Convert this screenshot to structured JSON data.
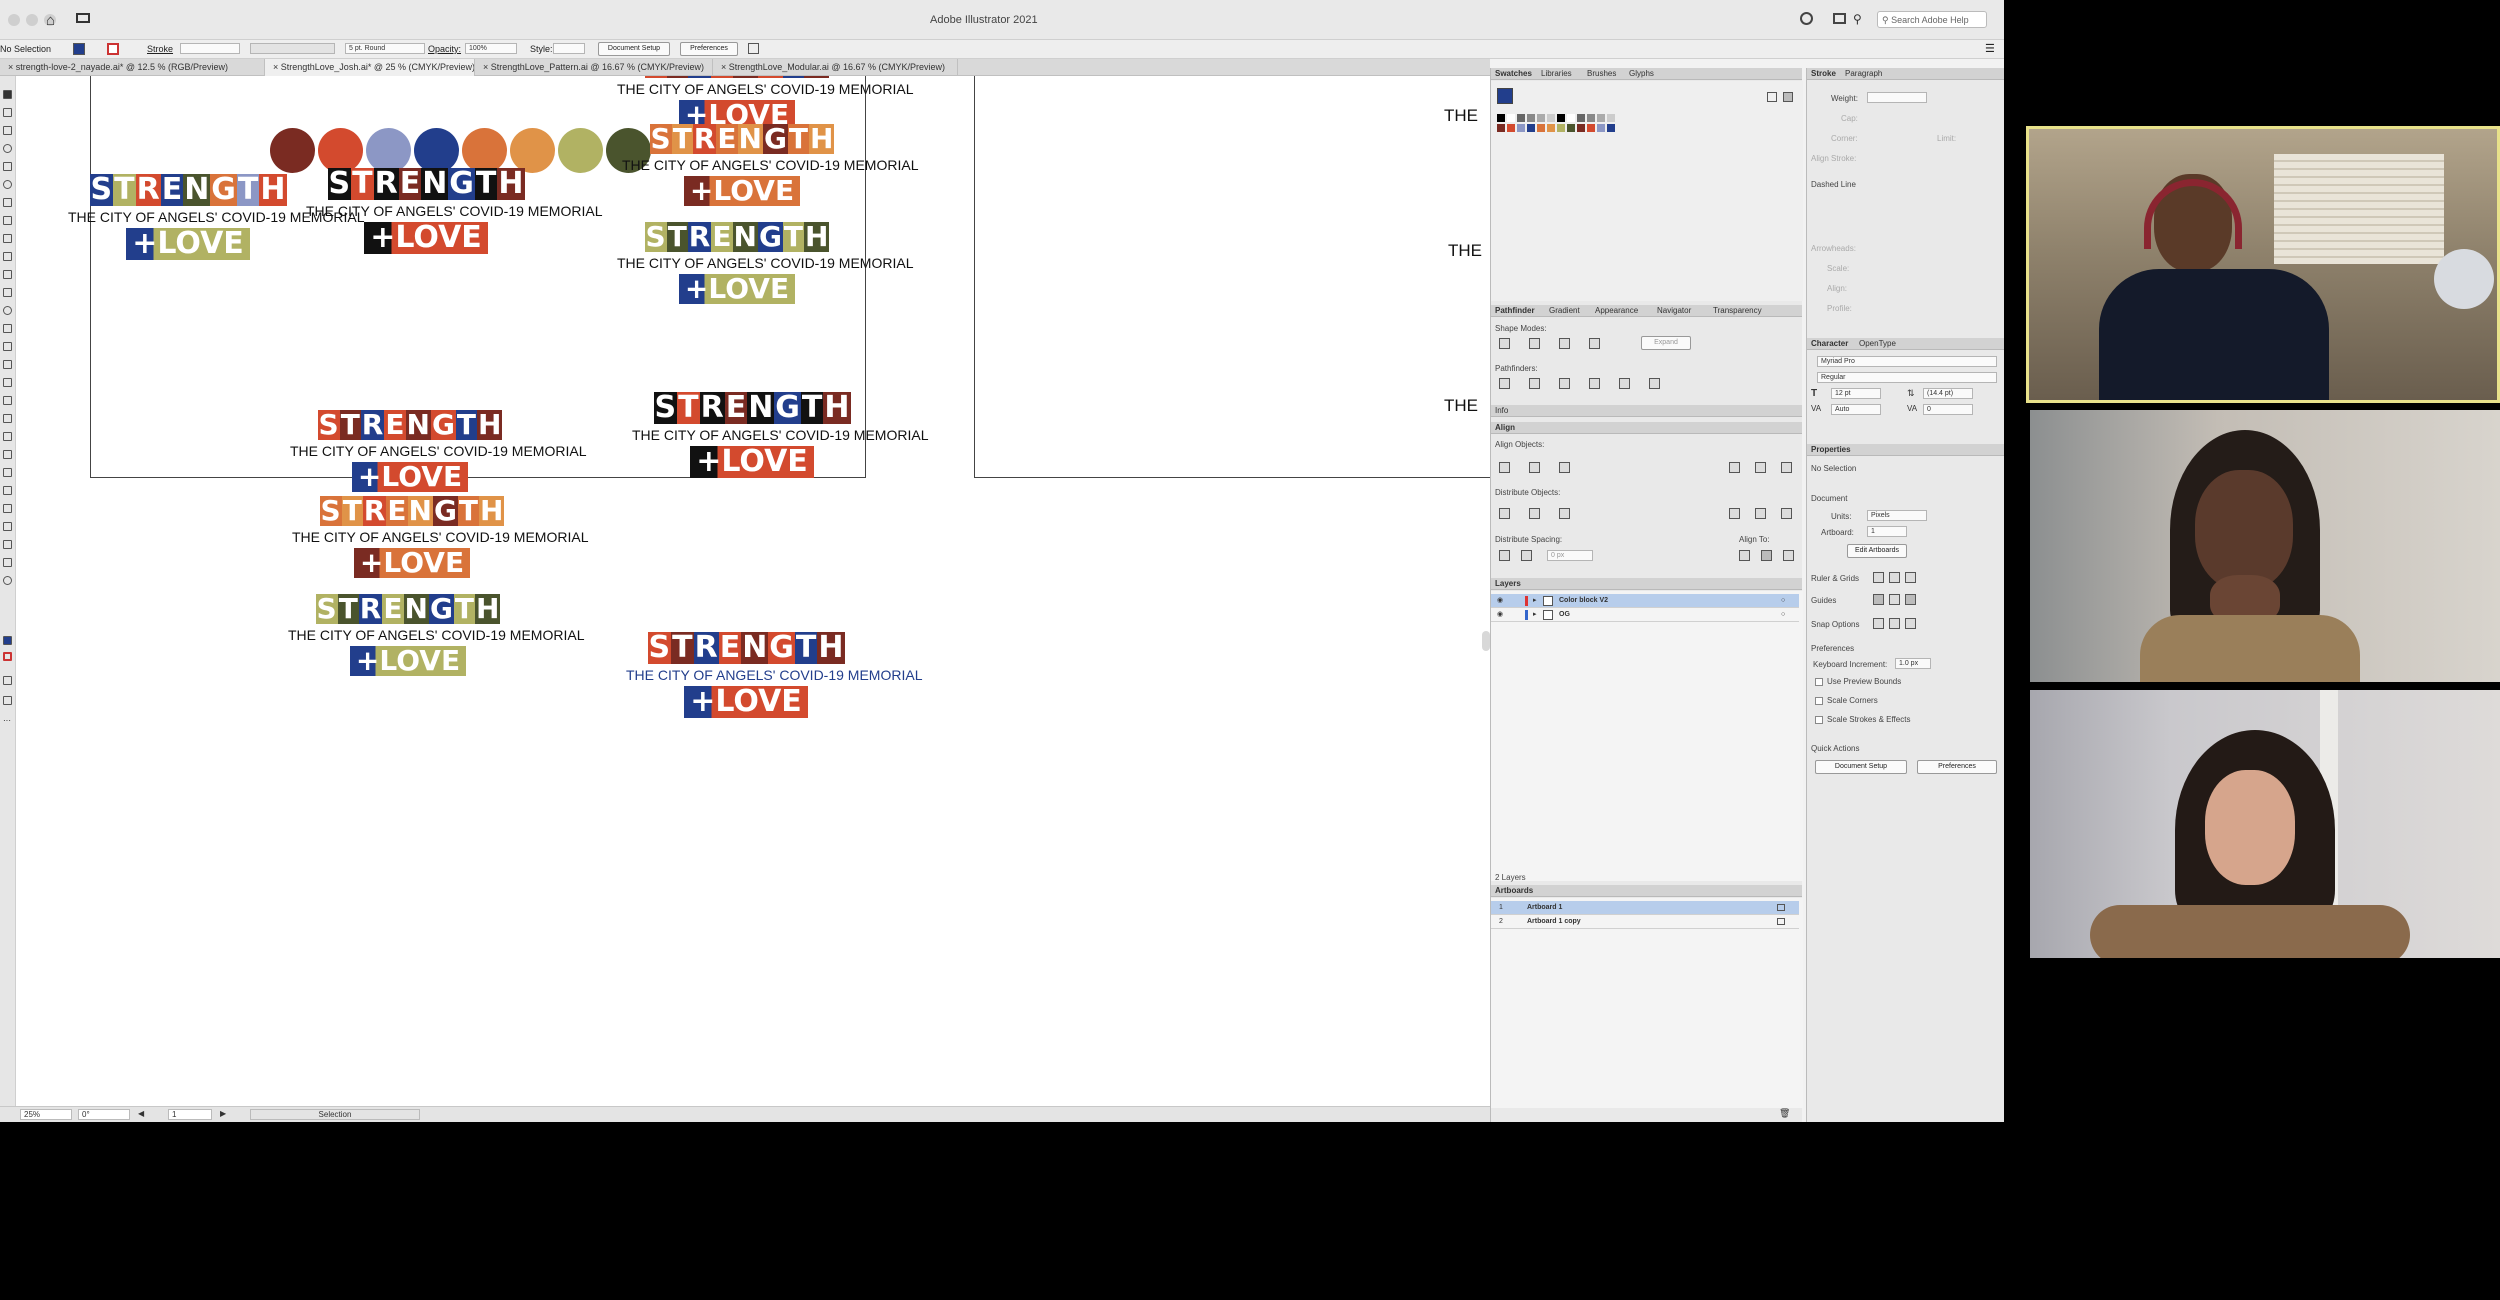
{
  "app": {
    "title": "Adobe Illustrator 2021",
    "search_placeholder": "Search Adobe Help"
  },
  "control_bar": {
    "selection": "No Selection",
    "stroke_label": "Stroke",
    "brush": "5 pt. Round",
    "opacity_label": "Opacity:",
    "opacity_value": "100%",
    "style_label": "Style:",
    "document_setup": "Document Setup",
    "preferences": "Preferences"
  },
  "tabs": [
    {
      "label": "strength-love-2_nayade.ai* @ 12.5 % (RGB/Preview)"
    },
    {
      "label": "StrengthLove_Josh.ai* @ 25 % (CMYK/Preview)"
    },
    {
      "label": "StrengthLove_Pattern.ai @ 16.67 % (CMYK/Preview)"
    },
    {
      "label": "StrengthLove_Modular.ai @ 16.67 % (CMYK/Preview)"
    }
  ],
  "artwork": {
    "headline": "STRENGTH",
    "subtitle": "THE CITY OF ANGELS' COVID-19 MEMORIAL",
    "love": "+LOVE",
    "partial_the": "THE"
  },
  "palette": [
    "#7a2b22",
    "#d34a2e",
    "#8c97c5",
    "#223e8c",
    "#d9733a",
    "#e09348",
    "#b1b263",
    "#4a542d"
  ],
  "status": {
    "zoom": "25%",
    "rotation": "0°",
    "artboard_num": "1",
    "tool": "Selection"
  },
  "swatch_panel": {
    "tabs": [
      "Swatches",
      "Libraries",
      "Brushes",
      "Glyphs"
    ]
  },
  "stroke_panel": {
    "tabs": [
      "Stroke",
      "Paragraph"
    ],
    "weight": "Weight:",
    "cap": "Cap:",
    "corner": "Corner:",
    "limit": "Limit:",
    "align_stroke": "Align Stroke:",
    "dashed": "Dashed Line",
    "arrowheads": "Arrowheads:",
    "scale": "Scale:",
    "align": "Align:",
    "profile": "Profile:"
  },
  "pathfinder_panel": {
    "tabs": [
      "Pathfinder",
      "Gradient",
      "Appearance",
      "Navigator",
      "Transparency"
    ],
    "shape_modes": "Shape Modes:",
    "expand": "Expand",
    "pathfinders": "Pathfinders:"
  },
  "info_panel": {
    "title": "Info"
  },
  "align_panel": {
    "title": "Align",
    "align_objects": "Align Objects:",
    "distribute_objects": "Distribute Objects:",
    "distribute_spacing": "Distribute Spacing:",
    "align_to": "Align To:",
    "spacing_value": "0 px"
  },
  "layers_panel": {
    "title": "Layers",
    "layers": [
      {
        "name": "Color block V2",
        "selected": true
      },
      {
        "name": "OG",
        "selected": false
      }
    ],
    "count": "2 Layers"
  },
  "artboards_panel": {
    "title": "Artboards",
    "items": [
      {
        "num": "1",
        "name": "Artboard 1",
        "selected": true
      },
      {
        "num": "2",
        "name": "Artboard 1 copy",
        "selected": false
      }
    ]
  },
  "character_panel": {
    "tabs": [
      "Character",
      "OpenType"
    ],
    "font": "Myriad Pro",
    "style": "Regular",
    "size": "12 pt",
    "leading": "(14.4 pt)",
    "kerning": "Auto",
    "tracking": "0"
  },
  "properties_panel": {
    "title": "Properties",
    "no_selection": "No Selection",
    "document": "Document",
    "units_label": "Units:",
    "units": "Pixels",
    "artboard_label": "Artboard:",
    "artboard_value": "1",
    "edit_artboards": "Edit Artboards",
    "ruler_grids": "Ruler & Grids",
    "guides": "Guides",
    "snap_options": "Snap Options",
    "preferences": "Preferences",
    "keyboard_increment": "Keyboard Increment:",
    "keyboard_value": "1.0 px",
    "checkboxes": [
      "Use Preview Bounds",
      "Scale Corners",
      "Scale Strokes & Effects"
    ],
    "quick_actions": "Quick Actions",
    "document_setup": "Document Setup",
    "preferences_btn": "Preferences"
  },
  "participants": 3
}
